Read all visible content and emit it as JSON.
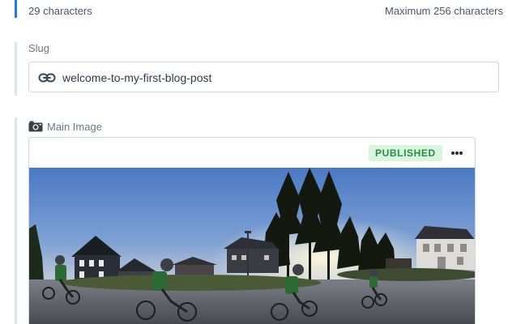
{
  "title_field": {
    "character_count": "29 characters",
    "max_hint": "Maximum 256 characters"
  },
  "slug": {
    "label": "Slug",
    "value": "welcome-to-my-first-blog-post",
    "icon": "link-icon"
  },
  "main_image": {
    "label": "Main Image",
    "icon": "camera-icon",
    "status": "PUBLISHED",
    "menu_icon": "more-horizontal-icon",
    "image_subject": "children cycling on a road at sunset"
  },
  "colors": {
    "accent_border": "#2276fc",
    "field_border": "#dde3ea",
    "published_bg": "#d8f5dd",
    "published_text": "#2a8c44"
  }
}
